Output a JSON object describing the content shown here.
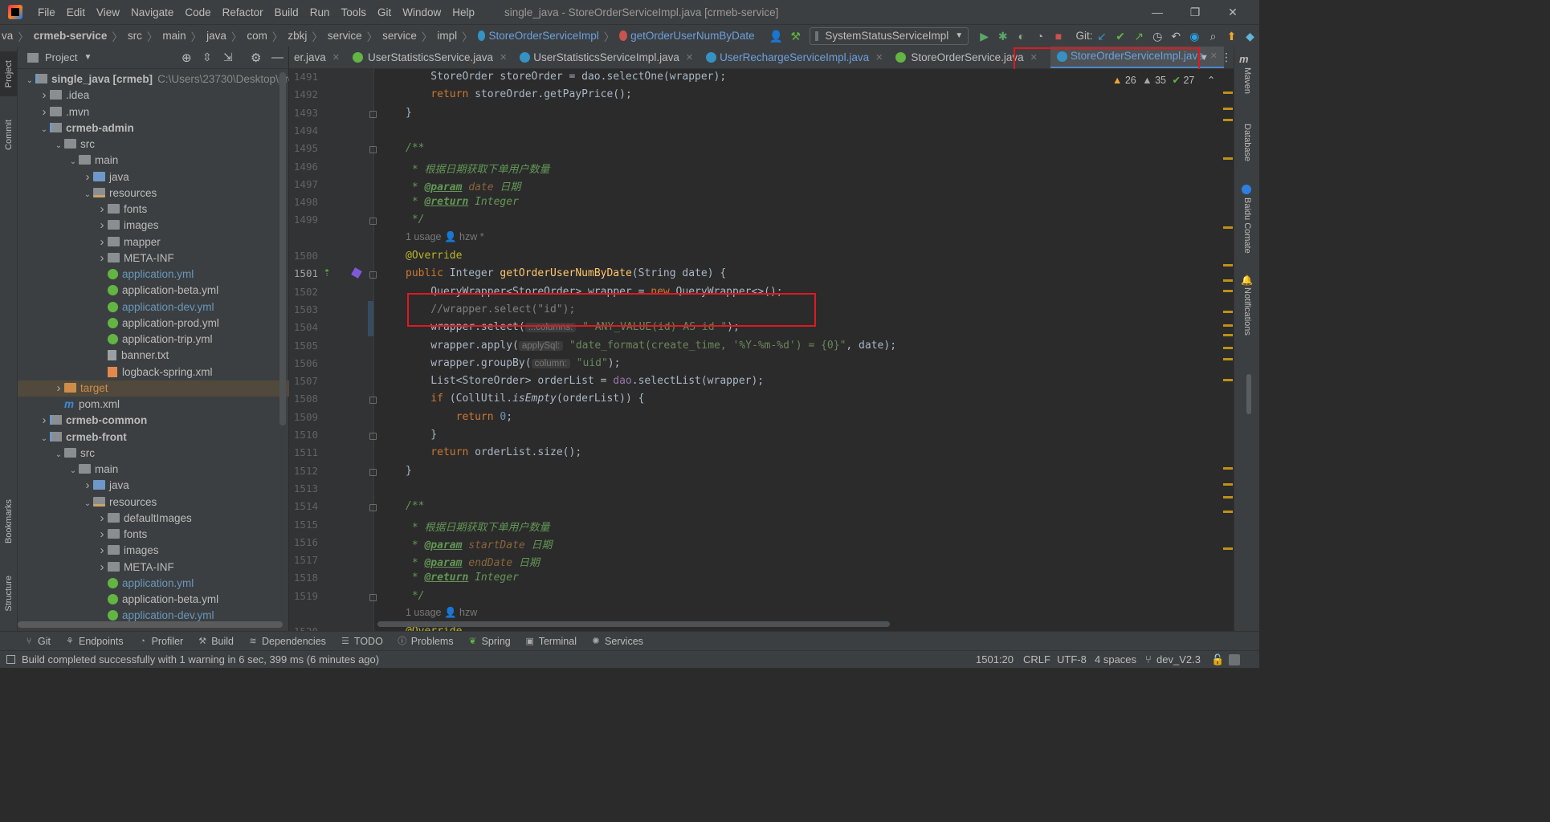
{
  "window": {
    "title": "single_java - StoreOrderServiceImpl.java [crmeb-service]",
    "menu": [
      "File",
      "Edit",
      "View",
      "Navigate",
      "Code",
      "Refactor",
      "Build",
      "Run",
      "Tools",
      "Git",
      "Window",
      "Help"
    ]
  },
  "breadcrumb": {
    "items": [
      "va",
      "crmeb-service",
      "src",
      "main",
      "java",
      "com",
      "zbkj",
      "service",
      "service",
      "impl",
      "StoreOrderServiceImpl",
      "getOrderUserNumByDate"
    ],
    "run_config": "SystemStatusServiceImpl",
    "git_label": "Git:"
  },
  "project_panel": {
    "title": "Project",
    "tree": [
      {
        "label": "single_java [crmeb]",
        "extra": "C:\\Users\\23730\\Desktop\\pro"
      },
      {
        "label": ".idea"
      },
      {
        "label": ".mvn"
      },
      {
        "label": "crmeb-admin"
      },
      {
        "label": "src"
      },
      {
        "label": "main"
      },
      {
        "label": "java"
      },
      {
        "label": "resources"
      },
      {
        "label": "fonts"
      },
      {
        "label": "images"
      },
      {
        "label": "mapper"
      },
      {
        "label": "META-INF"
      },
      {
        "label": "application.yml"
      },
      {
        "label": "application-beta.yml"
      },
      {
        "label": "application-dev.yml"
      },
      {
        "label": "application-prod.yml"
      },
      {
        "label": "application-trip.yml"
      },
      {
        "label": "banner.txt"
      },
      {
        "label": "logback-spring.xml"
      },
      {
        "label": "target"
      },
      {
        "label": "pom.xml"
      },
      {
        "label": "crmeb-common"
      },
      {
        "label": "crmeb-front"
      },
      {
        "label": "src"
      },
      {
        "label": "main"
      },
      {
        "label": "java"
      },
      {
        "label": "resources"
      },
      {
        "label": "defaultImages"
      },
      {
        "label": "fonts"
      },
      {
        "label": "images"
      },
      {
        "label": "META-INF"
      },
      {
        "label": "application.yml"
      },
      {
        "label": "application-beta.yml"
      },
      {
        "label": "application-dev.yml"
      }
    ]
  },
  "left_strip": [
    "Project",
    "Commit",
    "Bookmarks",
    "Structure"
  ],
  "right_strip": [
    "Maven",
    "Database",
    "Baidu Comate",
    "Notifications"
  ],
  "tabs": [
    {
      "label": "er.java"
    },
    {
      "label": "UserStatisticsService.java"
    },
    {
      "label": "UserStatisticsServiceImpl.java"
    },
    {
      "label": "UserRechargeServiceImpl.java"
    },
    {
      "label": "StoreOrderService.java"
    },
    {
      "label": "StoreOrderServiceImpl.java"
    }
  ],
  "inspections": {
    "warnings": "26",
    "weak_warnings": "35",
    "ok": "27"
  },
  "editor": {
    "line_numbers": [
      "1491",
      "1492",
      "1493",
      "1494",
      "1495",
      "1496",
      "1497",
      "1498",
      "1499",
      "1500",
      "1501",
      "1502",
      "1503",
      "1504",
      "1505",
      "1506",
      "1507",
      "1508",
      "1509",
      "1510",
      "1511",
      "1512",
      "1513",
      "1514",
      "1515",
      "1516",
      "1517",
      "1518",
      "1519",
      "1520"
    ],
    "usage1": "1 usage",
    "author1": "hzw *",
    "usage2": "1 usage",
    "author2": "hzw",
    "l1491": "    StoreOrder storeOrder = dao.selectOne(wrapper);",
    "l1492a": "    ",
    "l1492kw": "return",
    "l1492b": " storeOrder.getPayPrice();",
    "l1493": "}",
    "l1495": "/**",
    "l1496": " * 根据日期获取下单用户数量",
    "l1497_tag": "@param",
    "l1497_name": " date",
    "l1497_desc": " 日期",
    "l1498_tag": "@return",
    "l1498_desc": " Integer",
    "l1499": " */",
    "l1500": "@Override",
    "l1501_kw": "public",
    "l1501_type": " Integer ",
    "l1501_fn": "getOrderUserNumByDate",
    "l1501_rest": "(String date) {",
    "l1502a": "    QueryWrapper<StoreOrder> wrapper = ",
    "l1502kw": "new",
    "l1502b": " QueryWrapper<>();",
    "l1503": "    //wrapper.select(\"id\");",
    "l1504a": "    wrapper.select(",
    "l1504hint": "...columns:",
    "l1504str": " \" ANY_VALUE(id) AS id \"",
    "l1504b": ");",
    "l1505a": "    wrapper.apply(",
    "l1505hint": "applySql:",
    "l1505str": " \"date_format(create_time, '%Y-%m-%d') = {0}\"",
    "l1505b": ", date);",
    "l1506a": "    wrapper.groupBy(",
    "l1506hint": "column:",
    "l1506str": " \"uid\"",
    "l1506b": ");",
    "l1507a": "    List<StoreOrder> orderList = ",
    "l1507fld": "dao",
    "l1507b": ".selectList(wrapper);",
    "l1508kw": "    if",
    "l1508a": " (CollUtil.",
    "l1508it": "isEmpty",
    "l1508b": "(orderList)) {",
    "l1509kw": "        return",
    "l1509num": " 0",
    "l1509b": ";",
    "l1510": "    }",
    "l1511kw": "    return",
    "l1511b": " orderList.size();",
    "l1512": "}",
    "l1514": "/**",
    "l1515": " * 根据日期获取下单用户数量",
    "l1516_tag": "@param",
    "l1516_name": " startDate",
    "l1516_desc": " 日期",
    "l1517_tag": "@param",
    "l1517_name": " endDate",
    "l1517_desc": " 日期",
    "l1518_tag": "@return",
    "l1518_desc": " Integer",
    "l1519": " */",
    "l1520": "@Override"
  },
  "bottom_tools": [
    "Git",
    "Endpoints",
    "Profiler",
    "Build",
    "Dependencies",
    "TODO",
    "Problems",
    "Spring",
    "Terminal",
    "Services"
  ],
  "status": {
    "message": "Build completed successfully with 1 warning in 6 sec, 399 ms (6 minutes ago)",
    "position": "1501:20",
    "line_sep": "CRLF",
    "encoding": "UTF-8",
    "indent": "4 spaces",
    "branch": "dev_V2.3"
  },
  "colors": {
    "highlight_box": "#e0191e",
    "accent": "#4a88c7"
  }
}
